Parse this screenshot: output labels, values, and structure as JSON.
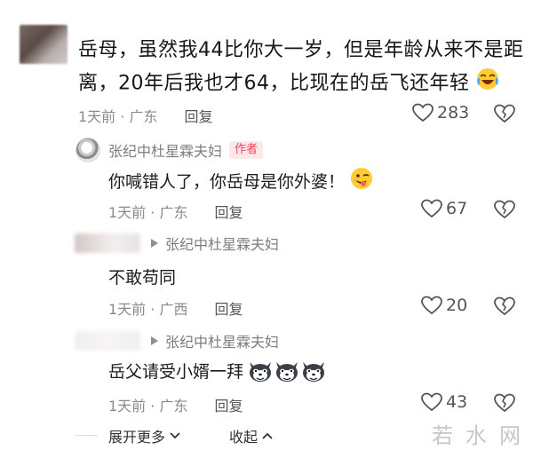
{
  "comments": [
    {
      "text_line1": "岳母，虽然我44比你大一岁，但是年龄从来不是距",
      "text_line2": "离，20年后我也才64，比现在的岳飞还年轻",
      "time": "1天前 · 广东",
      "reply_label": "回复",
      "likes": "283",
      "emoji": "laughing-crying-emoji"
    }
  ],
  "replies": [
    {
      "author": "张纪中杜星霖夫妇",
      "badge": "作者",
      "text": "你喊错人了，你岳母是你外婆！",
      "time": "1天前 · 广东",
      "reply_label": "回复",
      "likes": "67",
      "emoji": "winking-tongue-emoji"
    },
    {
      "reply_to": "张纪中杜星霖夫妇",
      "text": "不敢苟同",
      "time": "1天前 · 广西",
      "reply_label": "回复",
      "likes": "20"
    },
    {
      "reply_to": "张纪中杜星霖夫妇",
      "text": "岳父请受小婿一拜",
      "time": "1天前 · 广东",
      "reply_label": "回复",
      "likes": "43",
      "emoji": "husky-dog-emoji"
    }
  ],
  "footer": {
    "expand_label": "展开更多",
    "collapse_label": "收起"
  },
  "watermark": "若水网",
  "colors": {
    "badge_text": "#ff3b58",
    "badge_bg": "#ffe8ea",
    "meta_gray": "#8a8a8a"
  }
}
